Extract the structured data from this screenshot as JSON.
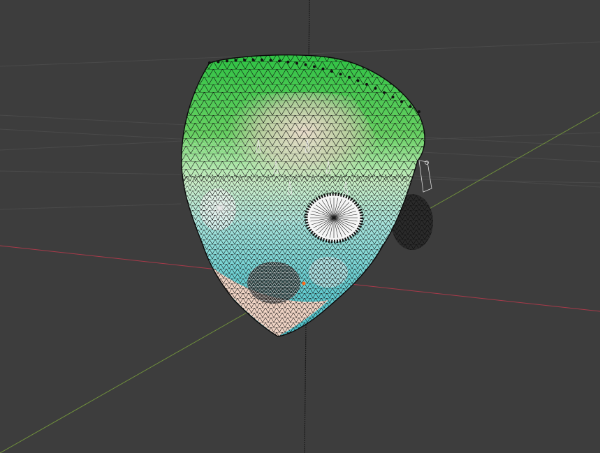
{
  "viewport": {
    "background_color": "#3d3d3d",
    "grid_line_color": "#4a4a4a",
    "axis_x_color": "#a83a4a",
    "axis_y_color": "#6f8f3c",
    "axis_z_color": "#1a1a1a"
  },
  "mesh": {
    "object": "head",
    "display_mode": "wireframe-overlay",
    "vertex_color": "#101010",
    "wire_color": "#0c0c0c",
    "skin_color": "#e8cfc0",
    "paint_gradient": [
      "#2fc244",
      "#9fe08a",
      "#d9f0e6",
      "#7ed8d8",
      "#3bb8c0"
    ],
    "selected_vertex_color": "#ff6a1a"
  },
  "icons": {
    "ear": "ear-mesh-icon",
    "left_eye": "left-eye-socket-icon",
    "right_eye": "right-eye-socket-icon"
  }
}
